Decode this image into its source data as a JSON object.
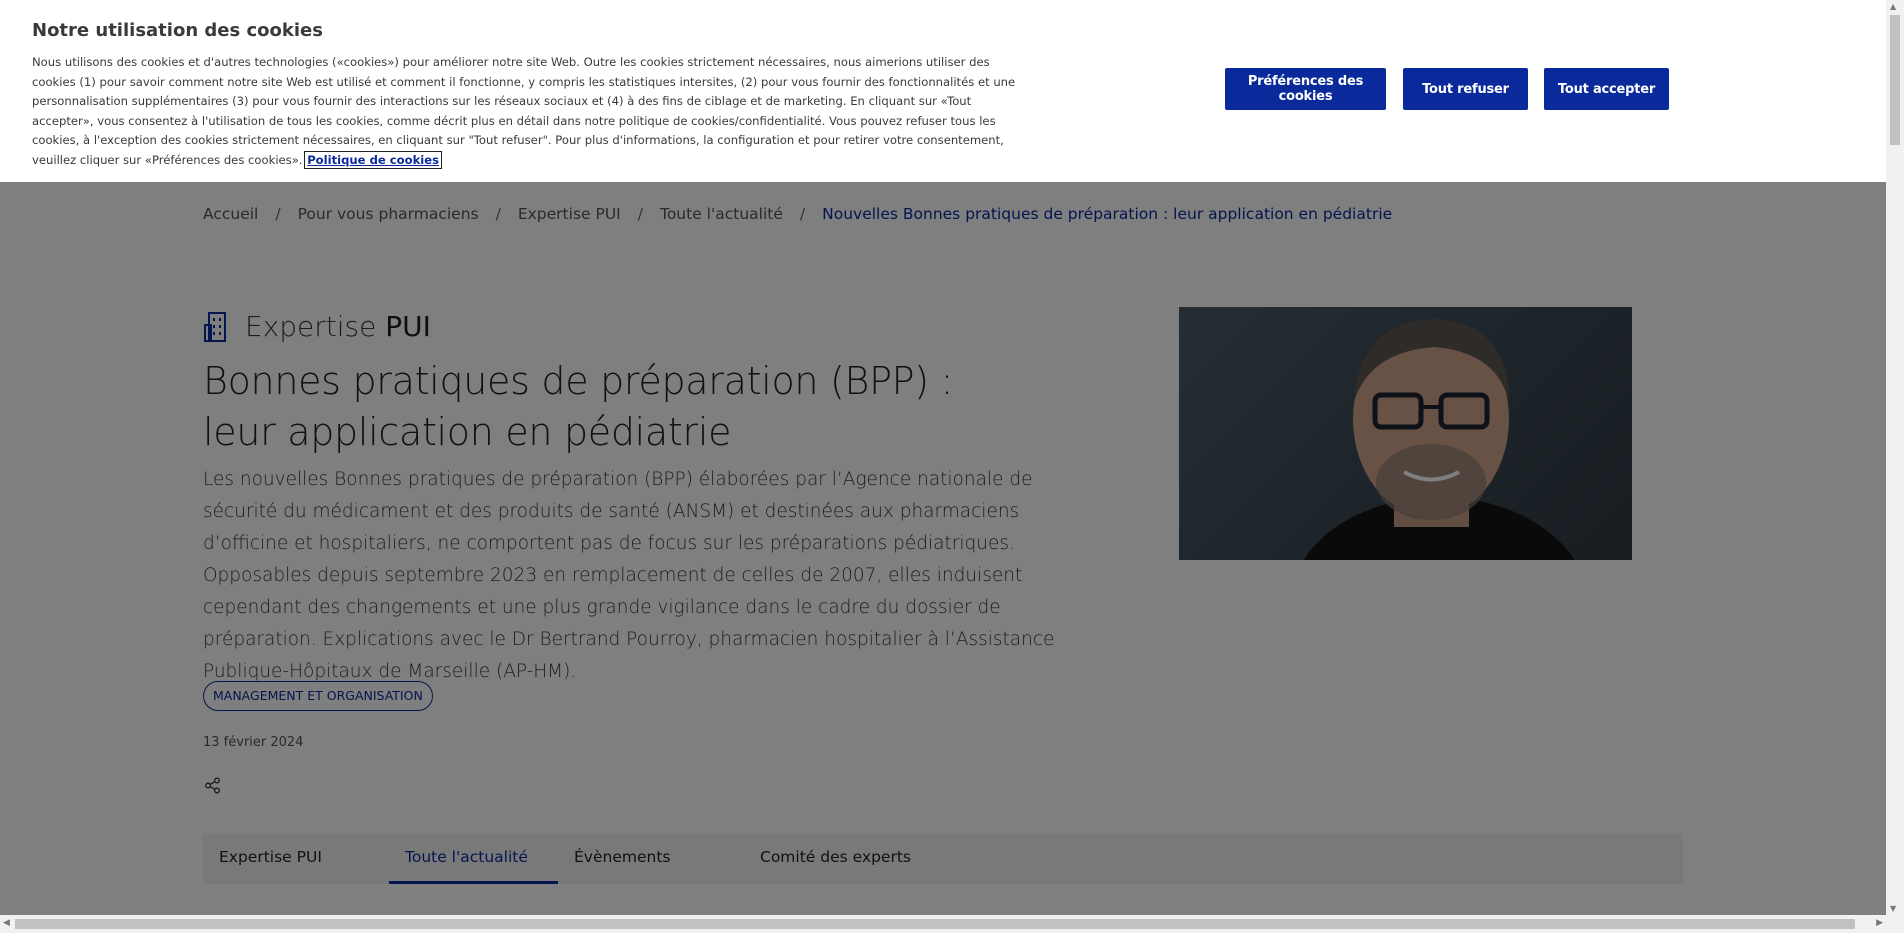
{
  "cookie_banner": {
    "title": "Notre utilisation des cookies",
    "text": "Nous utilisons des cookies et d'autres technologies («cookies») pour améliorer notre site Web. Outre les cookies strictement nécessaires, nous aimerions utiliser des cookies (1) pour savoir comment notre site Web est utilisé et comment il fonctionne, y compris les statistiques intersites, (2) pour vous fournir des fonctionnalités et une personnalisation supplémentaires (3) pour vous fournir des interactions sur les réseaux sociaux et (4) à des fins de ciblage et de marketing. En cliquant sur «Tout accepter», vous consentez à l'utilisation de tous les cookies, comme décrit plus en détail dans notre politique de cookies/confidentialité. Vous pouvez refuser tous les cookies, à l'exception des cookies strictement nécessaires, en cliquant sur \"Tout refuser\". Pour plus d'informations, la configuration et pour retirer votre consentement, veuillez cliquer sur «Préférences des cookies».",
    "policy_link": "Politique de cookies",
    "btn_preferences": "Préférences des cookies",
    "btn_refuse": "Tout refuser",
    "btn_accept": "Tout accepter"
  },
  "breadcrumb": {
    "items": [
      "Accueil",
      "Pour vous pharmaciens",
      "Expertise PUI",
      "Toute l'actualité"
    ],
    "current": "Nouvelles Bonnes pratiques de préparation : leur application en pédiatrie"
  },
  "article": {
    "section_light": "Expertise",
    "section_bold": "PUI",
    "title": "Bonnes pratiques de préparation (BPP) : leur application en pédiatrie",
    "lede": "Les nouvelles Bonnes pratiques de préparation (BPP) élaborées par l’Agence nationale de sécurité du médicament et des produits de santé (ANSM) et destinées aux pharmaciens d’officine et hospitaliers, ne comportent pas de focus sur les préparations pédiatriques. Opposables depuis septembre 2023 en remplacement de celles de 2007, elles induisent cependant des changements et une plus grande vigilance dans le cadre du dossier de préparation. Explications avec le Dr Bertrand Pourroy, pharmacien hospitalier à l’Assistance Publique-Hôpitaux de Marseille (AP-HM).",
    "tag": "MANAGEMENT ET ORGANISATION",
    "date": "13 février 2024"
  },
  "tabs": [
    "Expertise PUI",
    "Toute l'actualité",
    "Évènements",
    "Comité des experts"
  ],
  "colors": {
    "brand": "#0a2a9c",
    "overlay": "rgba(0,0,0,0.5)"
  },
  "icons": [
    "building-icon",
    "share-icon"
  ]
}
